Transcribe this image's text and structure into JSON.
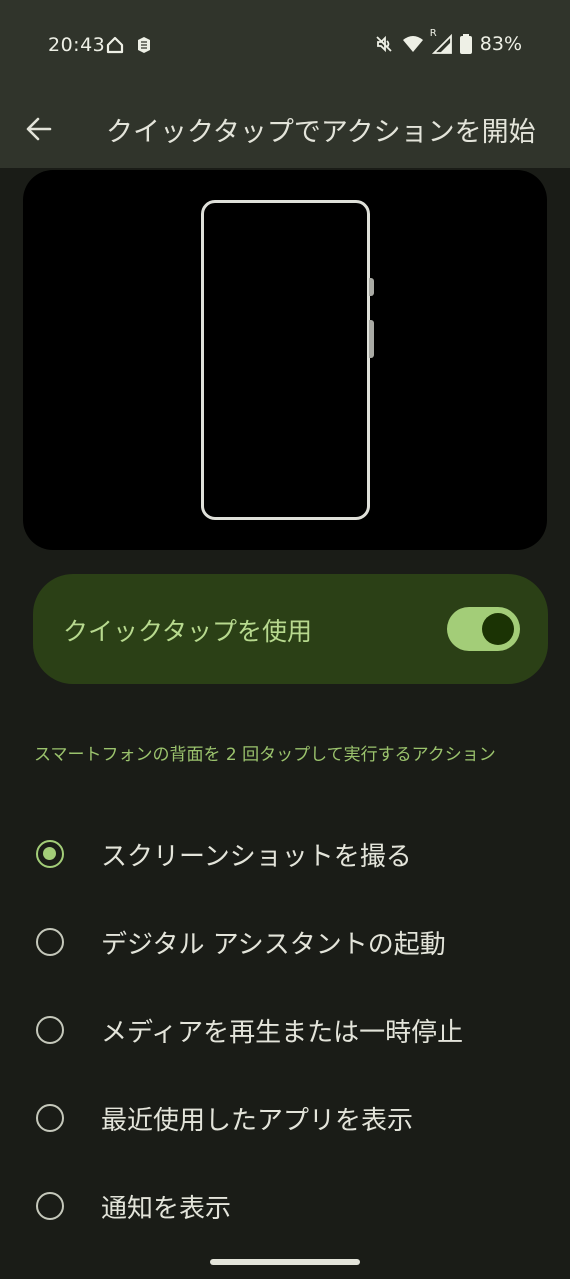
{
  "status_bar": {
    "time": "20:43",
    "battery_percent": "83%",
    "roaming_indicator": "R",
    "icons": [
      "home-icon",
      "notification-icon",
      "mute-icon",
      "wifi-icon",
      "signal-icon",
      "battery-icon"
    ]
  },
  "app_bar": {
    "title": "クイックタップでアクションを開始",
    "back_icon": "arrow-back-icon"
  },
  "main_switch": {
    "label": "クイックタップを使用",
    "enabled": true
  },
  "section": {
    "description": "スマートフォンの背面を 2 回タップして実行するアクション"
  },
  "options": [
    {
      "label": "スクリーンショットを撮る",
      "selected": true
    },
    {
      "label": "デジタル アシスタントの起動",
      "selected": false
    },
    {
      "label": "メディアを再生または一時停止",
      "selected": false
    },
    {
      "label": "最近使用したアプリを表示",
      "selected": false
    },
    {
      "label": "通知を表示",
      "selected": false
    }
  ],
  "colors": {
    "accent": "#a3cd78",
    "toggle_card": "#2b4016",
    "background": "#1a1c17",
    "app_bar": "#30342b"
  }
}
